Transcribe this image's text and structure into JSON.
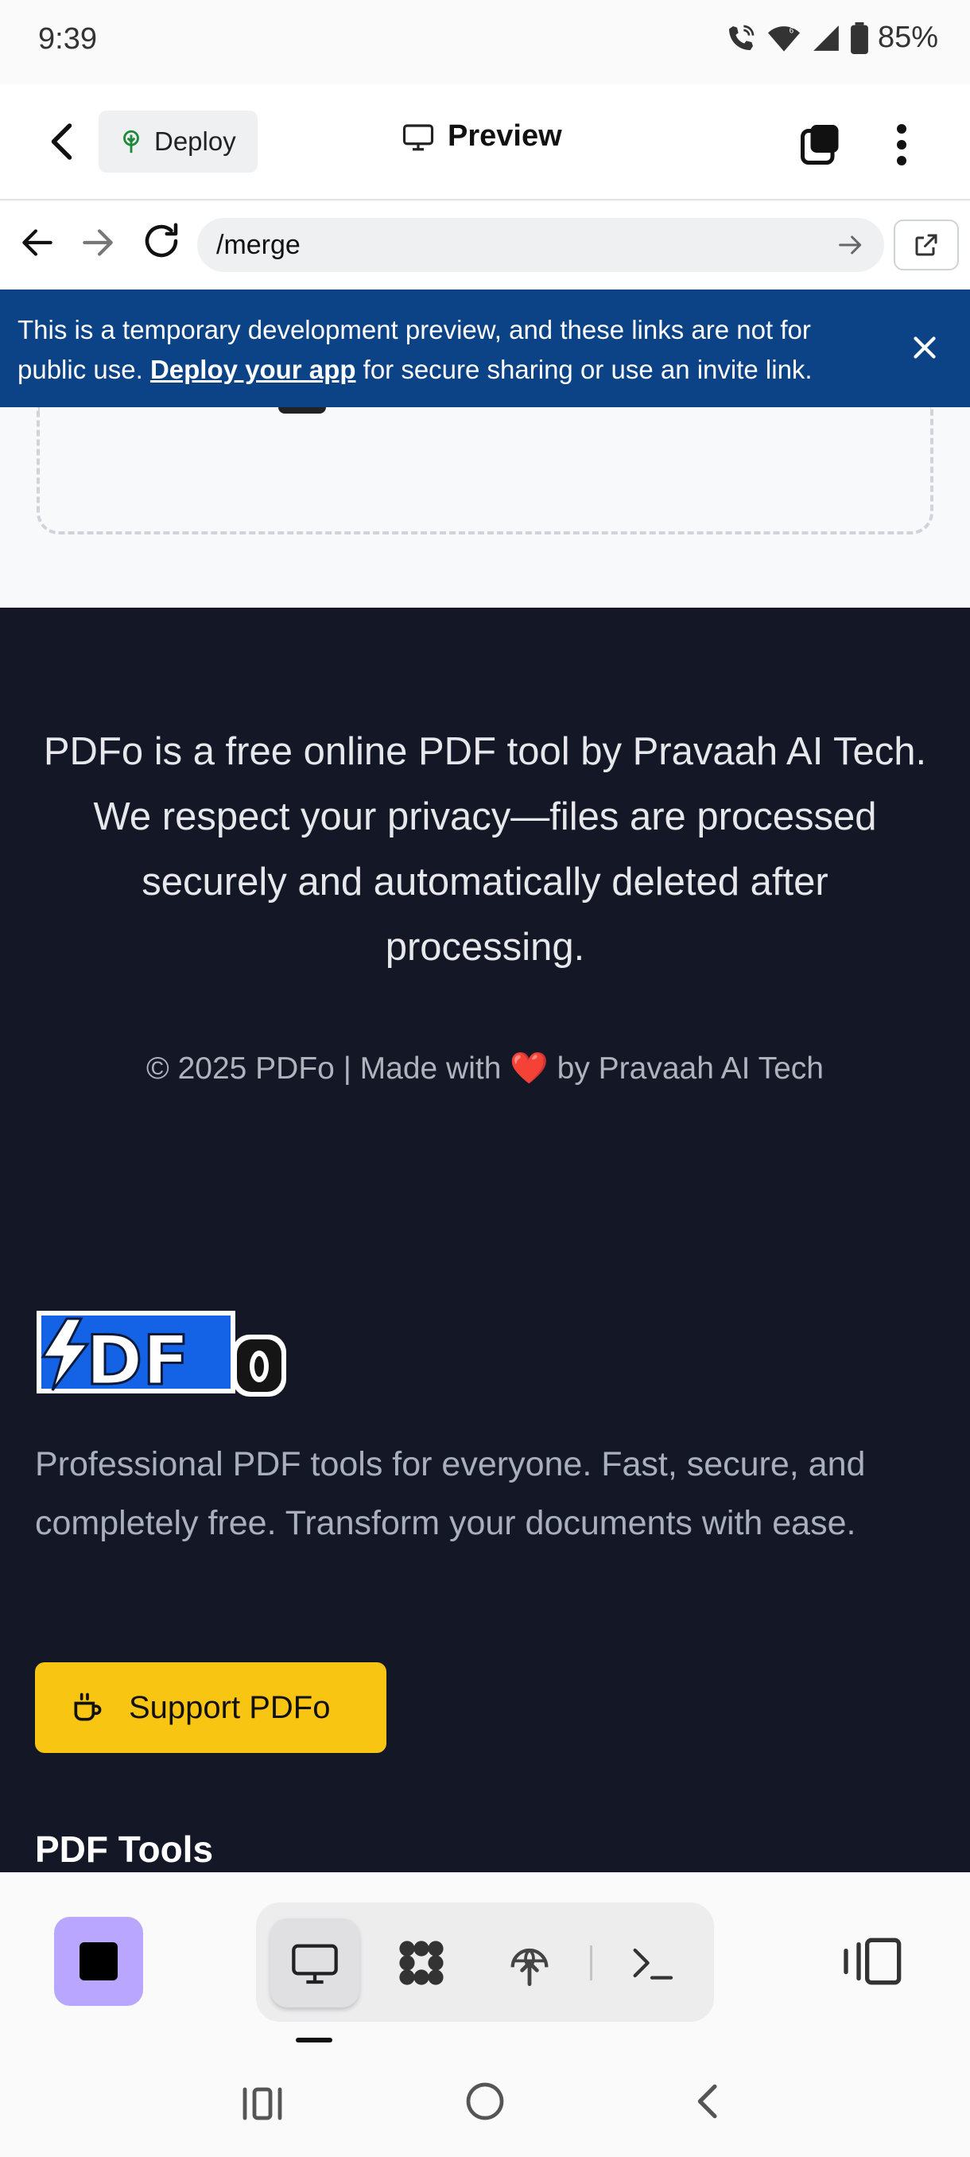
{
  "status_bar": {
    "time": "9:39",
    "battery": "85%",
    "icons": [
      "wifi-calling-icon",
      "wifi-6-icon",
      "signal-icon",
      "battery-icon"
    ]
  },
  "app_header": {
    "deploy_label": "Deploy",
    "preview_label": "Preview"
  },
  "browser": {
    "url": "/merge"
  },
  "banner": {
    "text_before": "This is a temporary development preview, and these links are not for public use. ",
    "link": "Deploy your app",
    "text_after": " for secure sharing or use an invite link."
  },
  "footer": {
    "privacy": "PDFo is a free online PDF tool by Pravaah AI Tech. We respect your privacy—files are processed securely and automatically deleted after processing.",
    "copyright_before": "© 2025 PDFo | Made with ",
    "heart": "❤️",
    "copyright_after": " by Pravaah AI Tech",
    "logo_text": "PDFo",
    "tagline": "Professional PDF tools for everyone. Fast, secure, and completely free. Transform your documents with ease.",
    "support_label": "Support PDFo",
    "tools_heading": "PDF Tools"
  },
  "colors": {
    "banner": "#0b4386",
    "footer": "#141826",
    "support_button": "#f9c513",
    "stop_button": "#b9a7ff",
    "logo_blue": "#1463e6"
  }
}
